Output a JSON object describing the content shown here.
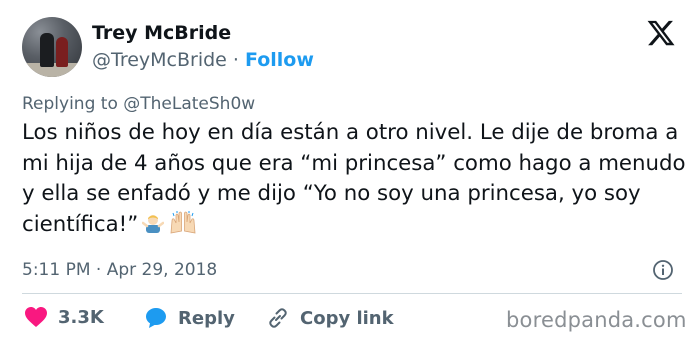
{
  "tweet": {
    "author_name": "Trey McBride",
    "author_handle": "@TreyMcBride",
    "separator": "·",
    "follow_label": "Follow",
    "replying_prefix": "Replying to",
    "replying_to": "@TheLateSh0w",
    "body": "Los niños de hoy en día están a otro nivel. Le dije de broma a mi hija de 4 años que era “mi princesa” como hago a menudo y ella se enfadó y me dijo “Yo no soy una princesa, yo soy científica!”",
    "time": "5:11 PM",
    "date": "Apr 29, 2018",
    "like_count": "3.3K",
    "reply_label": "Reply",
    "copy_link_label": "Copy link"
  },
  "icons": {
    "logo": "x-logo-icon",
    "info": "info-icon",
    "like": "heart-icon",
    "reply": "speech-bubble-icon",
    "copy": "link-icon",
    "emoji1": "person-shrugging-emoji-icon",
    "emoji2": "raising-hands-emoji-icon"
  },
  "colors": {
    "accent": "#1d9bf0",
    "like": "#f91880",
    "text": "#0f1419",
    "muted": "#536471"
  },
  "watermark": "boredpanda.com"
}
